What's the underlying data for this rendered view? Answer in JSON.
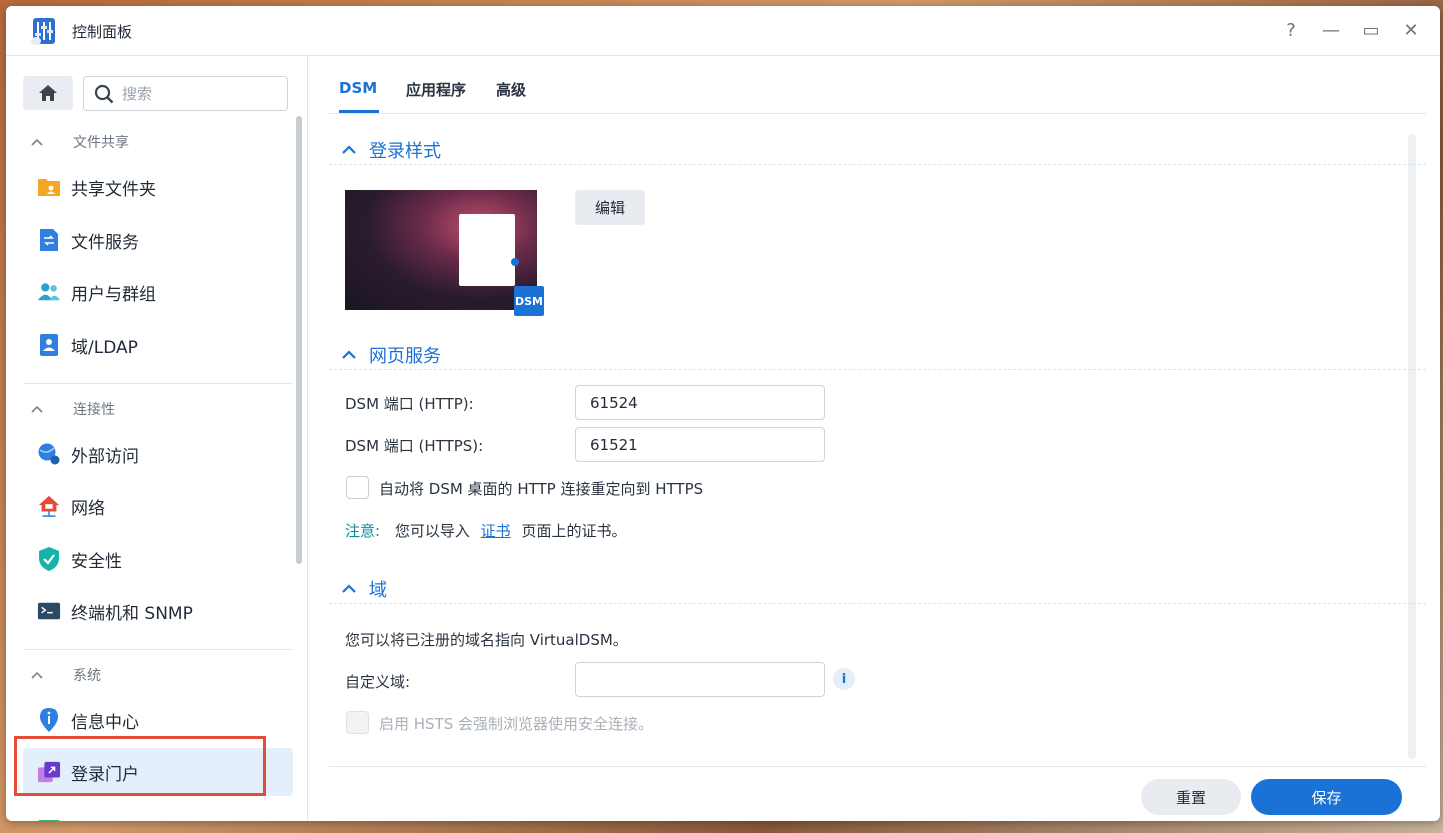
{
  "window": {
    "title": "控制面板",
    "controls": {
      "help": "?",
      "minimize": "—",
      "maximize": "▭",
      "close": "✕"
    }
  },
  "sidebar": {
    "search_placeholder": "搜索",
    "groups": [
      {
        "label": "文件共享",
        "items": [
          {
            "label": "共享文件夹",
            "icon": "shared-folder-icon"
          },
          {
            "label": "文件服务",
            "icon": "file-services-icon"
          },
          {
            "label": "用户与群组",
            "icon": "users-groups-icon"
          },
          {
            "label": "域/LDAP",
            "icon": "domain-ldap-icon"
          }
        ]
      },
      {
        "label": "连接性",
        "items": [
          {
            "label": "外部访问",
            "icon": "external-access-icon"
          },
          {
            "label": "网络",
            "icon": "network-icon"
          },
          {
            "label": "安全性",
            "icon": "security-icon"
          },
          {
            "label": "终端机和 SNMP",
            "icon": "terminal-icon"
          }
        ]
      },
      {
        "label": "系统",
        "items": [
          {
            "label": "信息中心",
            "icon": "info-center-icon"
          },
          {
            "label": "登录门户",
            "icon": "login-portal-icon",
            "active": true
          }
        ]
      }
    ]
  },
  "tabs": [
    "DSM",
    "应用程序",
    "高级"
  ],
  "sections": {
    "login_style": {
      "title": "登录样式",
      "edit_label": "编辑",
      "badge": "DSM"
    },
    "web_services": {
      "title": "网页服务",
      "http_label": "DSM 端口 (HTTP):",
      "http_value": "61524",
      "https_label": "DSM 端口 (HTTPS):",
      "https_value": "61521",
      "redirect_label": "自动将 DSM 桌面的 HTTP 连接重定向到 HTTPS",
      "note_key": "注意:",
      "note_prefix": "您可以导入",
      "note_link": "证书",
      "note_suffix": "页面上的证书。"
    },
    "domain": {
      "title": "域",
      "description": "您可以将已注册的域名指向 VirtualDSM。",
      "custom_label": "自定义域:",
      "custom_value": "",
      "hsts_label": "启用 HSTS 会强制浏览器使用安全连接。"
    }
  },
  "footer": {
    "reset": "重置",
    "save": "保存"
  },
  "colors": {
    "accent": "#1a72d6",
    "highlight": "#e34b3a"
  }
}
